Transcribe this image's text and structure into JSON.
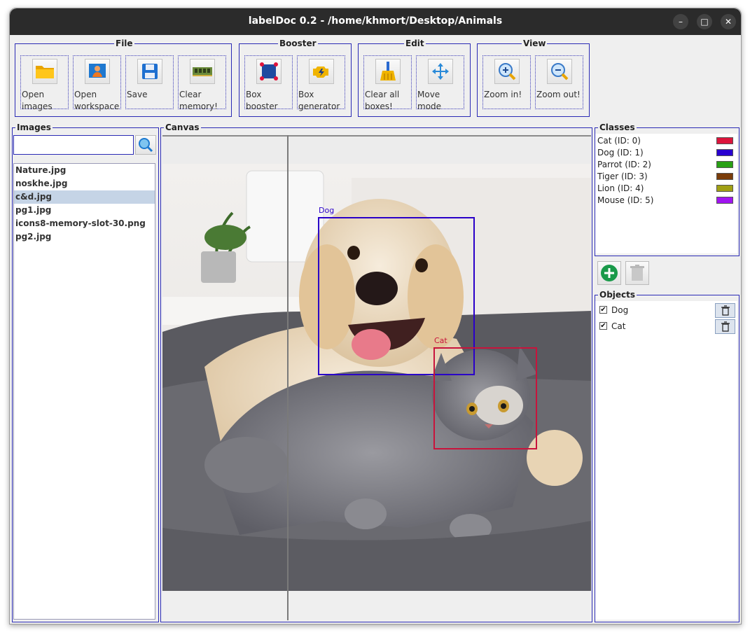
{
  "window": {
    "title": "labelDoc 0.2 - /home/khmort/Desktop/Animals",
    "minimize": "–",
    "maximize": "□",
    "close": "✕"
  },
  "toolbar": {
    "file": {
      "label": "File",
      "open_images": "Open images",
      "open_workspace": "Open workspace",
      "save": "Save",
      "clear_memory": "Clear memory!"
    },
    "booster": {
      "label": "Booster",
      "box_booster": "Box booster",
      "box_generator": "Box generator"
    },
    "edit": {
      "label": "Edit",
      "clear_all_boxes": "Clear all boxes!",
      "move_mode": "Move mode"
    },
    "view": {
      "label": "View",
      "zoom_in": "Zoom in!",
      "zoom_out": "Zoom out!"
    }
  },
  "images": {
    "label": "Images",
    "search_value": "",
    "files": [
      "Nature.jpg",
      "noskhe.jpg",
      "c&d.jpg",
      "pg1.jpg",
      "icons8-memory-slot-30.png",
      "pg2.jpg"
    ],
    "selected": "c&d.jpg"
  },
  "canvas": {
    "label": "Canvas",
    "boxes": [
      {
        "label": "Dog",
        "color": "#2a00c8"
      },
      {
        "label": "Cat",
        "color": "#c8143c"
      }
    ]
  },
  "classes": {
    "label": "Classes",
    "items": [
      {
        "label": "Cat (ID: 0)",
        "color": "#dc143c"
      },
      {
        "label": "Dog (ID: 1)",
        "color": "#2800d0"
      },
      {
        "label": "Parrot (ID: 2)",
        "color": "#28a014"
      },
      {
        "label": "Tiger (ID: 3)",
        "color": "#7a3c0a"
      },
      {
        "label": "Lion (ID: 4)",
        "color": "#a0a014"
      },
      {
        "label": "Mouse (ID: 5)",
        "color": "#a014f0"
      }
    ]
  },
  "objects": {
    "label": "Objects",
    "items": [
      {
        "label": "Dog",
        "checked": "✔"
      },
      {
        "label": "Cat",
        "checked": "✔"
      }
    ]
  }
}
